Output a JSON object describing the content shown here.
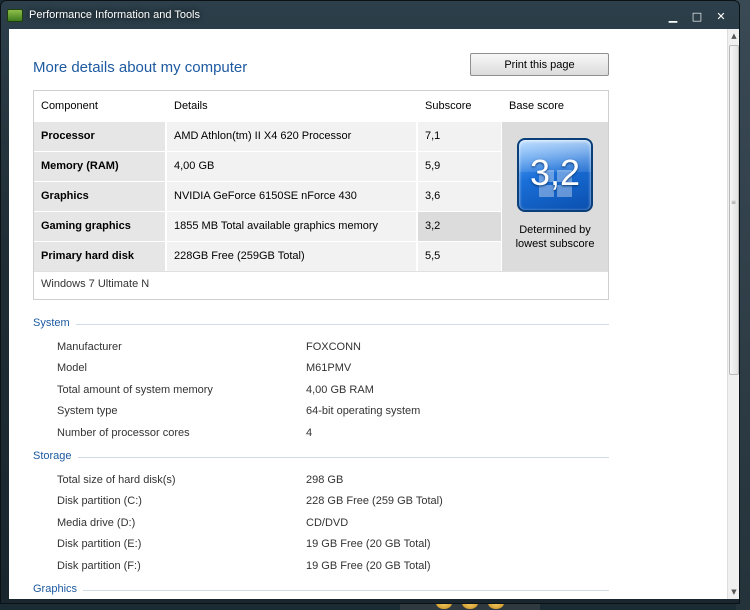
{
  "window": {
    "title": "Performance Information and Tools",
    "controls": {
      "minimize": "▁",
      "maximize": "□",
      "close": "✕"
    }
  },
  "page": {
    "title": "More details about my computer",
    "print_label": "Print this page"
  },
  "score_table": {
    "headers": {
      "component": "Component",
      "details": "Details",
      "subscore": "Subscore",
      "base": "Base score"
    },
    "rows": [
      {
        "component": "Processor",
        "details": "AMD Athlon(tm) II X4 620 Processor",
        "subscore": "7,1"
      },
      {
        "component": "Memory (RAM)",
        "details": "4,00 GB",
        "subscore": "5,9"
      },
      {
        "component": "Graphics",
        "details": "NVIDIA GeForce 6150SE nForce 430",
        "subscore": "3,6"
      },
      {
        "component": "Gaming graphics",
        "details": "1855 MB Total available graphics memory",
        "subscore": "3,2"
      },
      {
        "component": "Primary hard disk",
        "details": "228GB Free (259GB Total)",
        "subscore": "5,5"
      }
    ],
    "base_score": "3,2",
    "base_caption_1": "Determined by",
    "base_caption_2": "lowest subscore",
    "edition": "Windows 7 Ultimate N"
  },
  "system": {
    "title": "System",
    "items": [
      {
        "key": "Manufacturer",
        "value": "FOXCONN"
      },
      {
        "key": "Model",
        "value": "M61PMV"
      },
      {
        "key": "Total amount of system memory",
        "value": "4,00 GB RAM"
      },
      {
        "key": "System type",
        "value": "64-bit operating system"
      },
      {
        "key": "Number of processor cores",
        "value": "4"
      }
    ]
  },
  "storage": {
    "title": "Storage",
    "items": [
      {
        "key": "Total size of hard disk(s)",
        "value": "298 GB"
      },
      {
        "key": "Disk partition (C:)",
        "value": "228 GB Free (259 GB Total)"
      },
      {
        "key": "Media drive (D:)",
        "value": "CD/DVD"
      },
      {
        "key": "Disk partition (E:)",
        "value": "19 GB Free (20 GB Total)"
      },
      {
        "key": "Disk partition (F:)",
        "value": "19 GB Free (20 GB Total)"
      }
    ]
  },
  "graphics": {
    "title": "Graphics"
  },
  "colors": {
    "accent": "#1e5aa0",
    "badge": "#1a6fd8"
  }
}
